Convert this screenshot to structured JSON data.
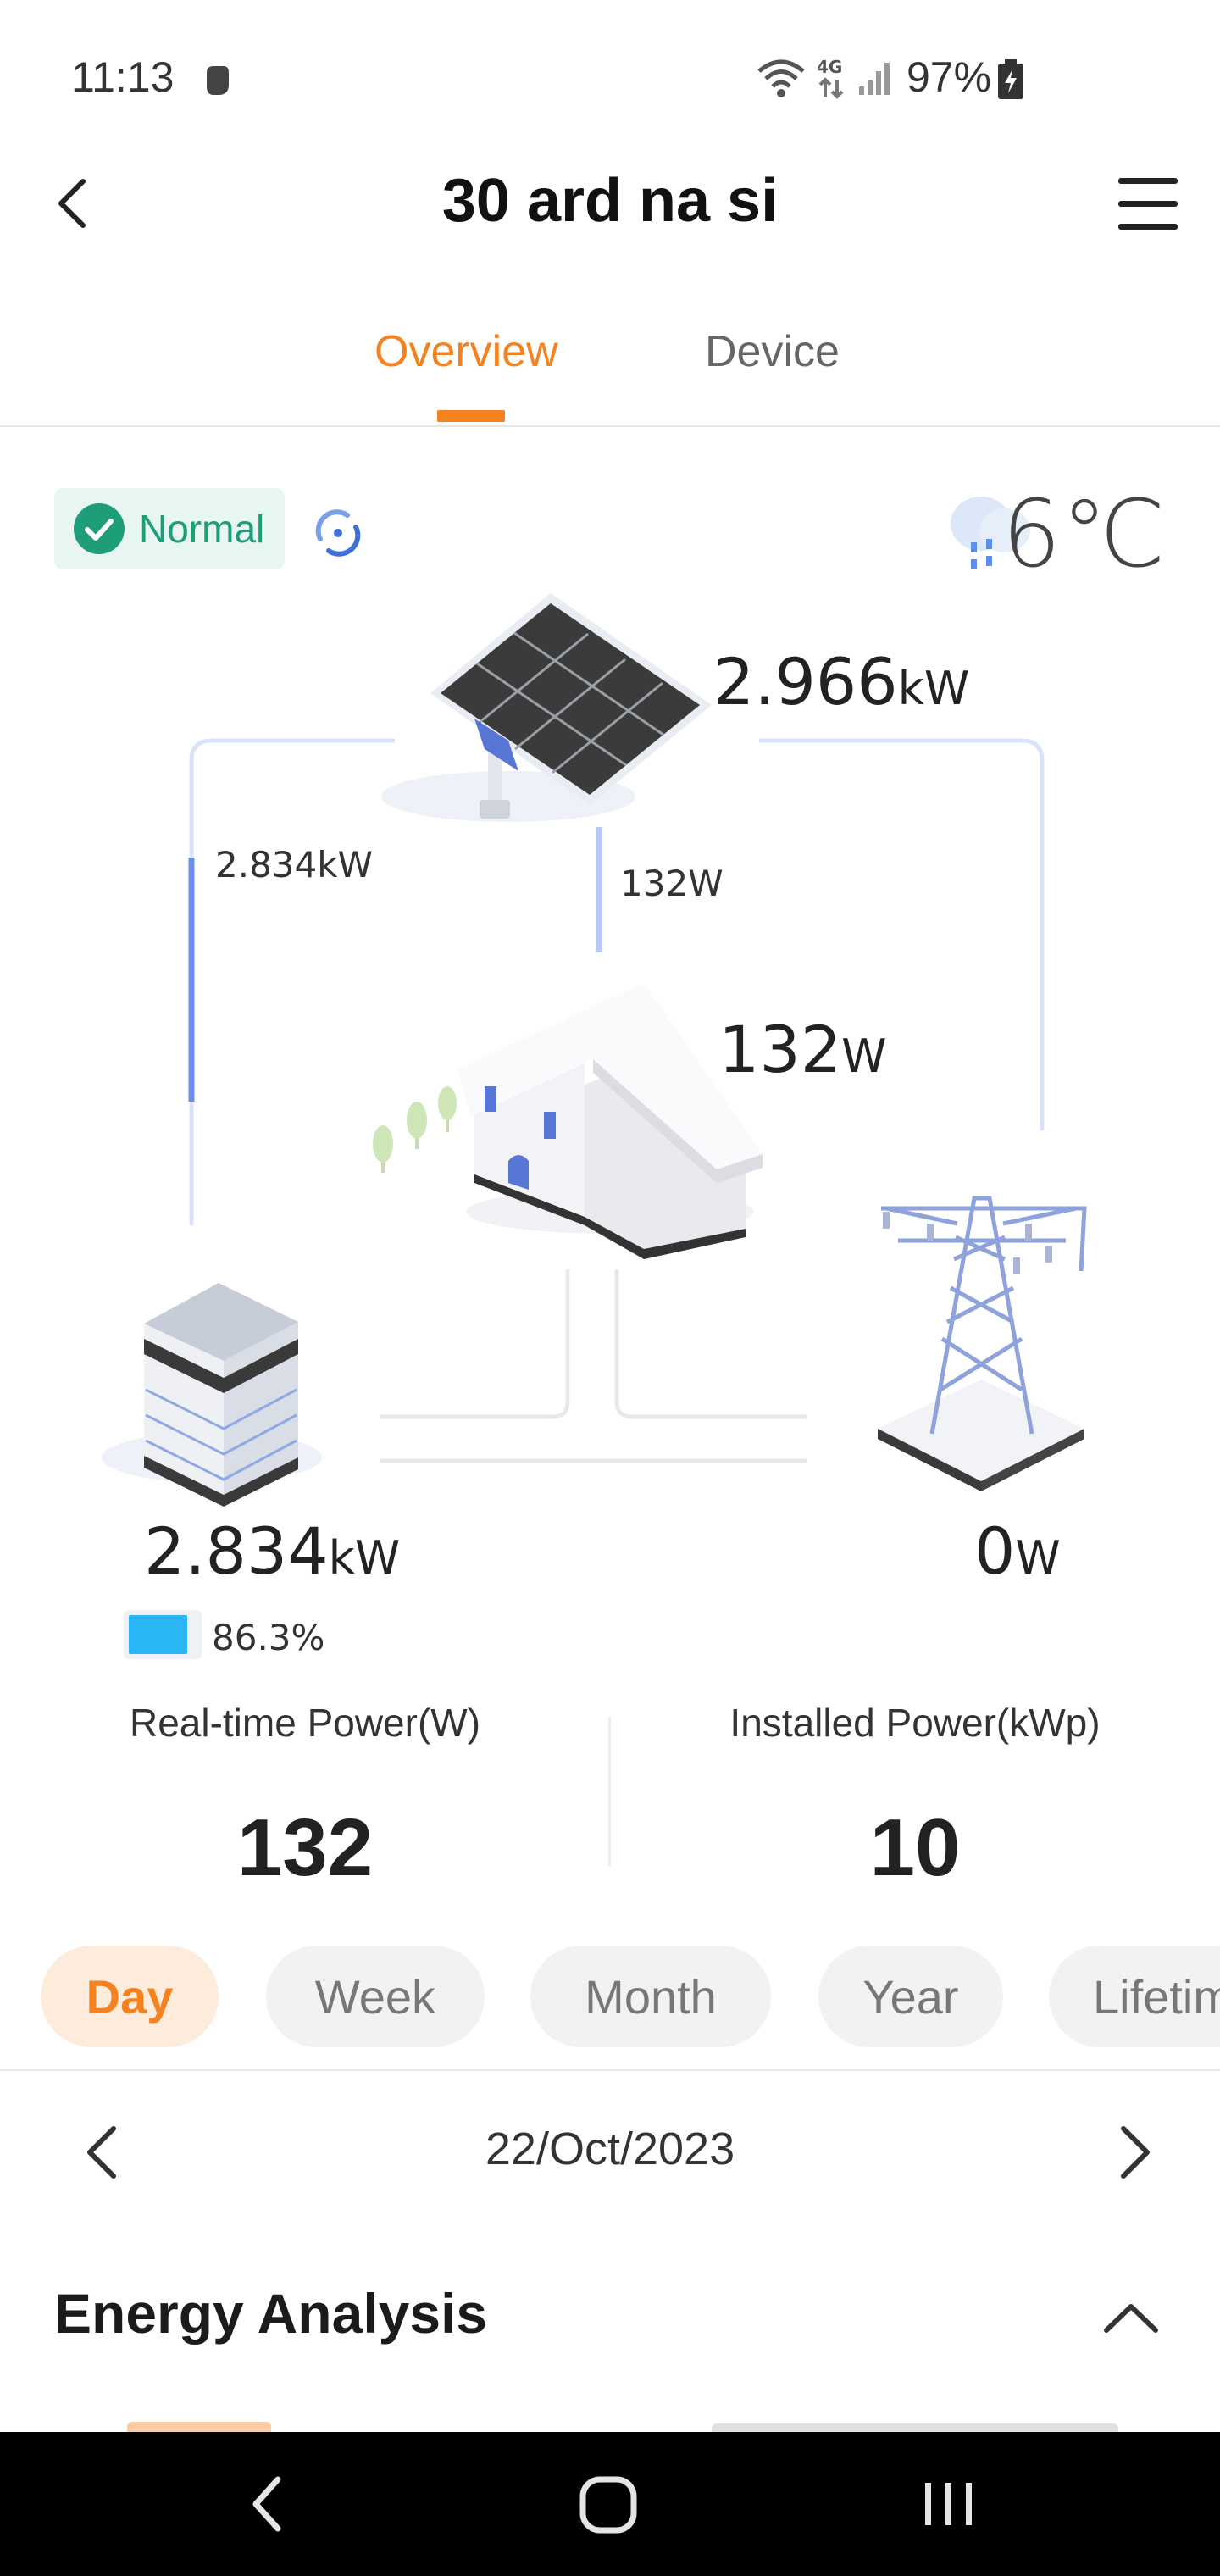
{
  "status_bar": {
    "time": "11:13",
    "battery": "97%",
    "icons": [
      "fist-icon",
      "wifi-6-icon",
      "4g-icon",
      "signal-icon",
      "battery-charging-icon"
    ]
  },
  "header": {
    "title": "30 ard na si",
    "back_icon": "back-chevron-icon",
    "menu_icon": "hamburger-menu-icon"
  },
  "tabs": [
    {
      "label": "Overview",
      "active": true
    },
    {
      "label": "Device",
      "active": false
    }
  ],
  "status_badge": {
    "label": "Normal",
    "icon": "check-circle-icon",
    "color": "#1e9e78"
  },
  "weather": {
    "temperature": "6℃",
    "icon": "cloud-rain-icon"
  },
  "flow": {
    "solar_power": {
      "value": "2.966",
      "unit": "kW"
    },
    "solar_to_battery": "2.834kW",
    "solar_to_home": "132W",
    "home_power": {
      "value": "132",
      "unit": "W"
    },
    "battery_power": {
      "value": "2.834",
      "unit": "kW"
    },
    "battery_soc": "86.3%",
    "battery_soc_fraction": 0.863,
    "grid_power": {
      "value": "0",
      "unit": "W"
    }
  },
  "stats": [
    {
      "label": "Real-time Power(W)",
      "value": "132"
    },
    {
      "label": "Installed Power(kWp)",
      "value": "10"
    }
  ],
  "periods": [
    {
      "label": "Day",
      "active": true
    },
    {
      "label": "Week",
      "active": false
    },
    {
      "label": "Month",
      "active": false
    },
    {
      "label": "Year",
      "active": false
    },
    {
      "label": "Lifetim",
      "active": false
    }
  ],
  "date_nav": {
    "date": "22/Oct/2023"
  },
  "energy_analysis": {
    "title": "Energy Analysis"
  },
  "colors": {
    "accent": "#f5821f",
    "normal": "#1e9e78",
    "flow_line": "#6b8fe8",
    "battery_fill": "#29b6f6"
  }
}
